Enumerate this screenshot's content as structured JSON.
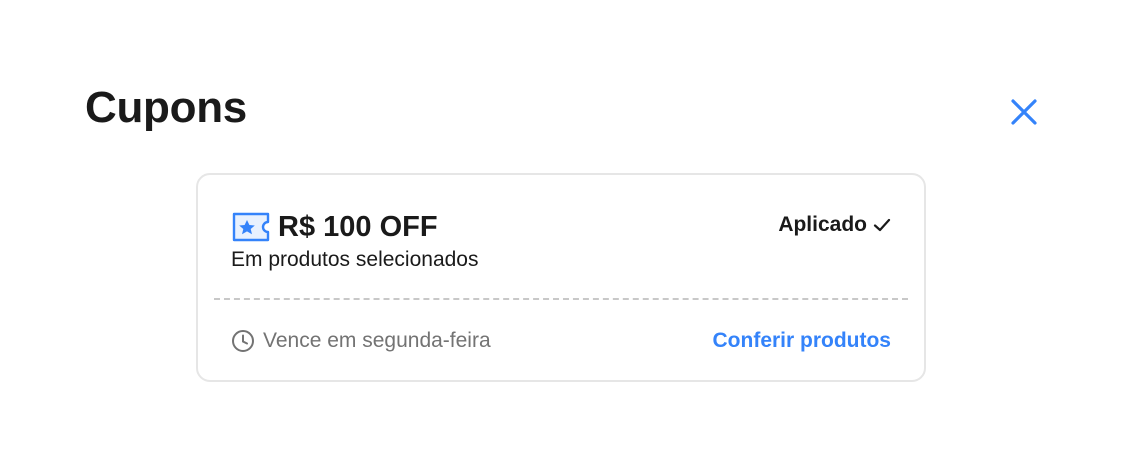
{
  "header": {
    "title": "Cupons",
    "close_icon": "close-icon"
  },
  "coupon": {
    "icon": "ticket-star-icon",
    "amount": "R$ 100 OFF",
    "description": "Em produtos selecionados",
    "status_label": "Aplicado",
    "status_icon": "check-icon",
    "expiry_icon": "clock-icon",
    "expiry_text": "Vence em segunda-feira",
    "action_label": "Conferir produtos"
  },
  "colors": {
    "accent": "#3483fa",
    "text": "#1a1a1a",
    "muted": "#737373",
    "border": "#e6e6e6",
    "divider": "#c8c8c8"
  }
}
